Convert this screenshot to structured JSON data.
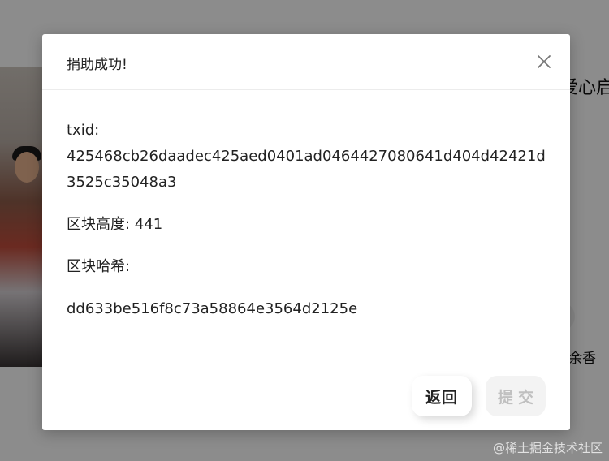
{
  "background": {
    "title_fragment": "爱心启",
    "author_fragment": "余香",
    "watermark": "@稀土掘金技术社区"
  },
  "dialog": {
    "title": "捐助成功!",
    "close_icon": "close-icon",
    "txid_label": "txid:",
    "txid_value": "425468cb26daadec425aed0401ad0464427080641d404d42421d3525c35048a3",
    "block_height_label": "区块高度: 441",
    "block_hash_label": "区块哈希:",
    "block_hash_value": "dd633be516f8c73a58864e3564d2125e",
    "back_label": "返回",
    "submit_label": "提交"
  },
  "colors": {
    "overlay": "#000000",
    "dialog_bg": "#ffffff",
    "text": "#222222",
    "disabled_text": "#c0c0c0"
  }
}
